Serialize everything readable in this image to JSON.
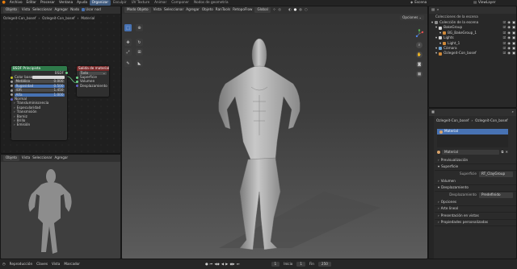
{
  "topbar": {
    "menu": [
      "Archivo",
      "Editar",
      "Procesar",
      "Ventana",
      "Ayuda"
    ],
    "workspaces": [
      "Organizar",
      "Esculpir",
      "UV Texture",
      "Animar",
      "Componer",
      "Nodos de geometría"
    ],
    "active_workspace": "Organizar",
    "scene": "Escena",
    "viewlayer": "ViewLayer"
  },
  "node_editor": {
    "header": {
      "mode": "Objeto",
      "menus": [
        "Vista",
        "Seleccionar",
        "Agregar",
        "Nodo"
      ],
      "use_nodes": "Usar nod"
    },
    "breadcrumb": [
      "Ozlegeit-Con_bosef",
      "Ozlegeit-Con_bosef",
      "Material"
    ],
    "bsdf": {
      "title": "BSDF Principista",
      "bsdf_label": "BSDF",
      "rows": [
        {
          "label": "Color base",
          "value": ""
        },
        {
          "label": "Metálico",
          "value": "0.000"
        },
        {
          "label": "Rugosidad",
          "value": "0.500"
        },
        {
          "label": "IOR",
          "value": "1.450"
        },
        {
          "label": "Alfa",
          "value": "1.000"
        }
      ],
      "sections": [
        "Normal",
        "Transluminiscencia",
        "Especularidad",
        "Transmisión",
        "Barniz",
        "Brillo",
        "Emisión"
      ]
    },
    "output": {
      "title": "Salida de material",
      "target": "Todo",
      "sockets": [
        "Superficie",
        "Volumen",
        "Desplazamiento"
      ]
    }
  },
  "preview": {
    "header": {
      "mode": "Objeto",
      "menus": [
        "Vista",
        "Seleccionar",
        "Agregar"
      ]
    }
  },
  "viewport": {
    "header": {
      "mode": "Modo Objeto",
      "menus": [
        "Vista",
        "Seleccionar",
        "Agregar",
        "Objeto"
      ],
      "addons": [
        "RanTools",
        "RetopoFlow"
      ],
      "transform": "Global"
    },
    "options": "Opciones"
  },
  "outliner": {
    "title": "Colecciones de la escena",
    "items": [
      {
        "label": "Colección de la escena",
        "depth": 0,
        "color": "#8e8e8e"
      },
      {
        "label": "BakeGroup",
        "depth": 1,
        "color": "#d6d6d6"
      },
      {
        "label": "BG_BakeGroup_1",
        "depth": 2,
        "color": "#d08a3a"
      },
      {
        "label": "Lights",
        "depth": 1,
        "color": "#d6d6d6"
      },
      {
        "label": "Light_1",
        "depth": 2,
        "color": "#d08a3a"
      },
      {
        "label": "Cámara",
        "depth": 1,
        "color": "#6fa6d6"
      },
      {
        "label": "Ozlegeit-Con_bosef",
        "depth": 1,
        "color": "#d08a3a"
      }
    ]
  },
  "properties": {
    "breadcrumb": [
      "Ozlegeit-Con_bosef",
      "Ozlegeit-Con_bosef"
    ],
    "slot": "Material",
    "datablock": "Material",
    "sections": [
      {
        "label": "Previsualización",
        "open": false
      },
      {
        "label": "Superficie",
        "open": true,
        "field_label": "Superficie",
        "field_value": "RT_ClayGroup"
      },
      {
        "label": "Volumen",
        "open": false
      },
      {
        "label": "Desplazamiento",
        "open": true,
        "field_label": "Desplazamiento",
        "field_value": "Predefinido"
      },
      {
        "label": "Opciones",
        "open": false
      },
      {
        "label": "Arte lineal",
        "open": false
      },
      {
        "label": "Presentación en vistas",
        "open": false
      },
      {
        "label": "Propiedades personalizadas",
        "open": false
      }
    ]
  },
  "timeline": {
    "menus": [
      "Reproducción",
      "Claves",
      "Vista",
      "Marcador"
    ],
    "current": "1",
    "start_label": "Inicio",
    "start": "1",
    "end_label": "Fin",
    "end": "250"
  },
  "colors": {
    "accent": "#4772b3",
    "active_ws": "#3f5a7d",
    "bsdf_header": "#2e7a4a",
    "output_header": "#7a2a2a"
  }
}
